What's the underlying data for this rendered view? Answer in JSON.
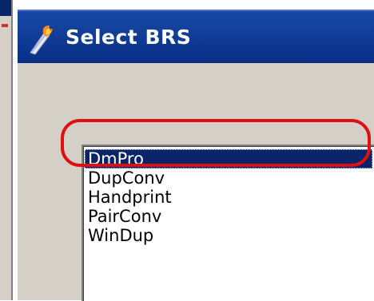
{
  "window": {
    "title": "Select BRS",
    "icon": "torch-icon"
  },
  "list": {
    "items": [
      "DmPro",
      "DupConv",
      "Handprint",
      "PairConv",
      "WinDup"
    ],
    "selected": "DmPro"
  },
  "colors": {
    "titlebar": "#0a246a",
    "selection": "#0a246a",
    "highlight_ring": "#e01010",
    "dialog_bg": "#d4d0c8"
  }
}
